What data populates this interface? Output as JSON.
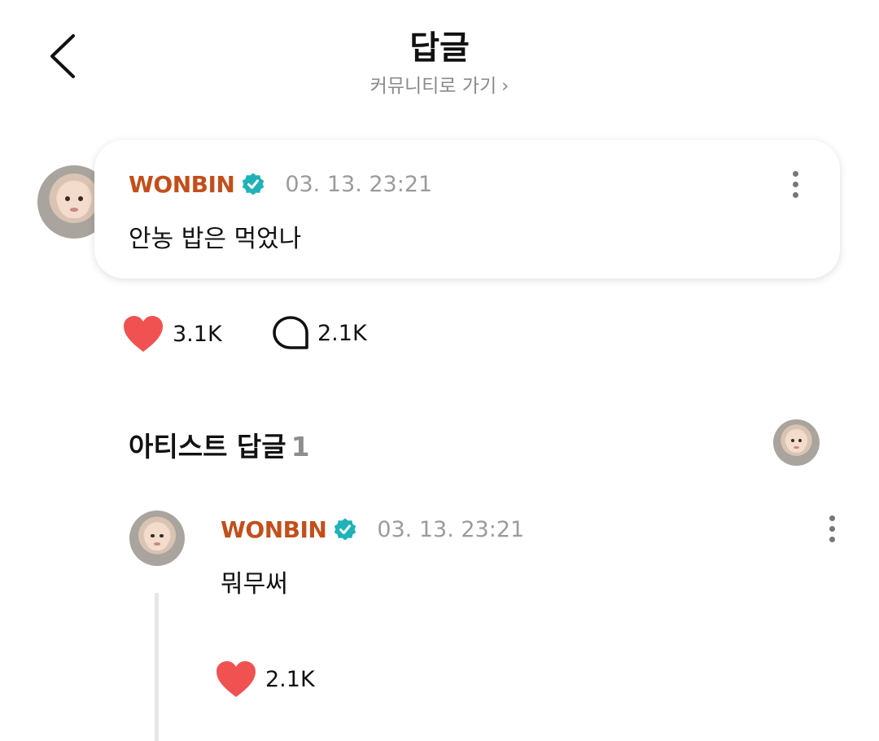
{
  "header": {
    "title": "답글",
    "community_link": "커뮤니티로 가기",
    "community_chevron": "›"
  },
  "post": {
    "author": "WONBIN",
    "date": "03. 13. 23:21",
    "text": "안농 밥은 먹었나",
    "likes": "3.1K",
    "comments": "2.1K"
  },
  "artist_replies": {
    "label": "아티스트 답글",
    "count": "1"
  },
  "reply": {
    "author": "WONBIN",
    "date": "03. 13. 23:21",
    "text": "뭐무써",
    "likes": "2.1K"
  },
  "colors": {
    "author": "#c24f1b",
    "verified": "#1fb2b8",
    "heart": "#f05252",
    "muted": "#9b9b9b"
  },
  "icons": [
    "back-icon",
    "chevron-right-icon",
    "verified-icon",
    "more-icon",
    "heart-icon",
    "comment-icon"
  ]
}
